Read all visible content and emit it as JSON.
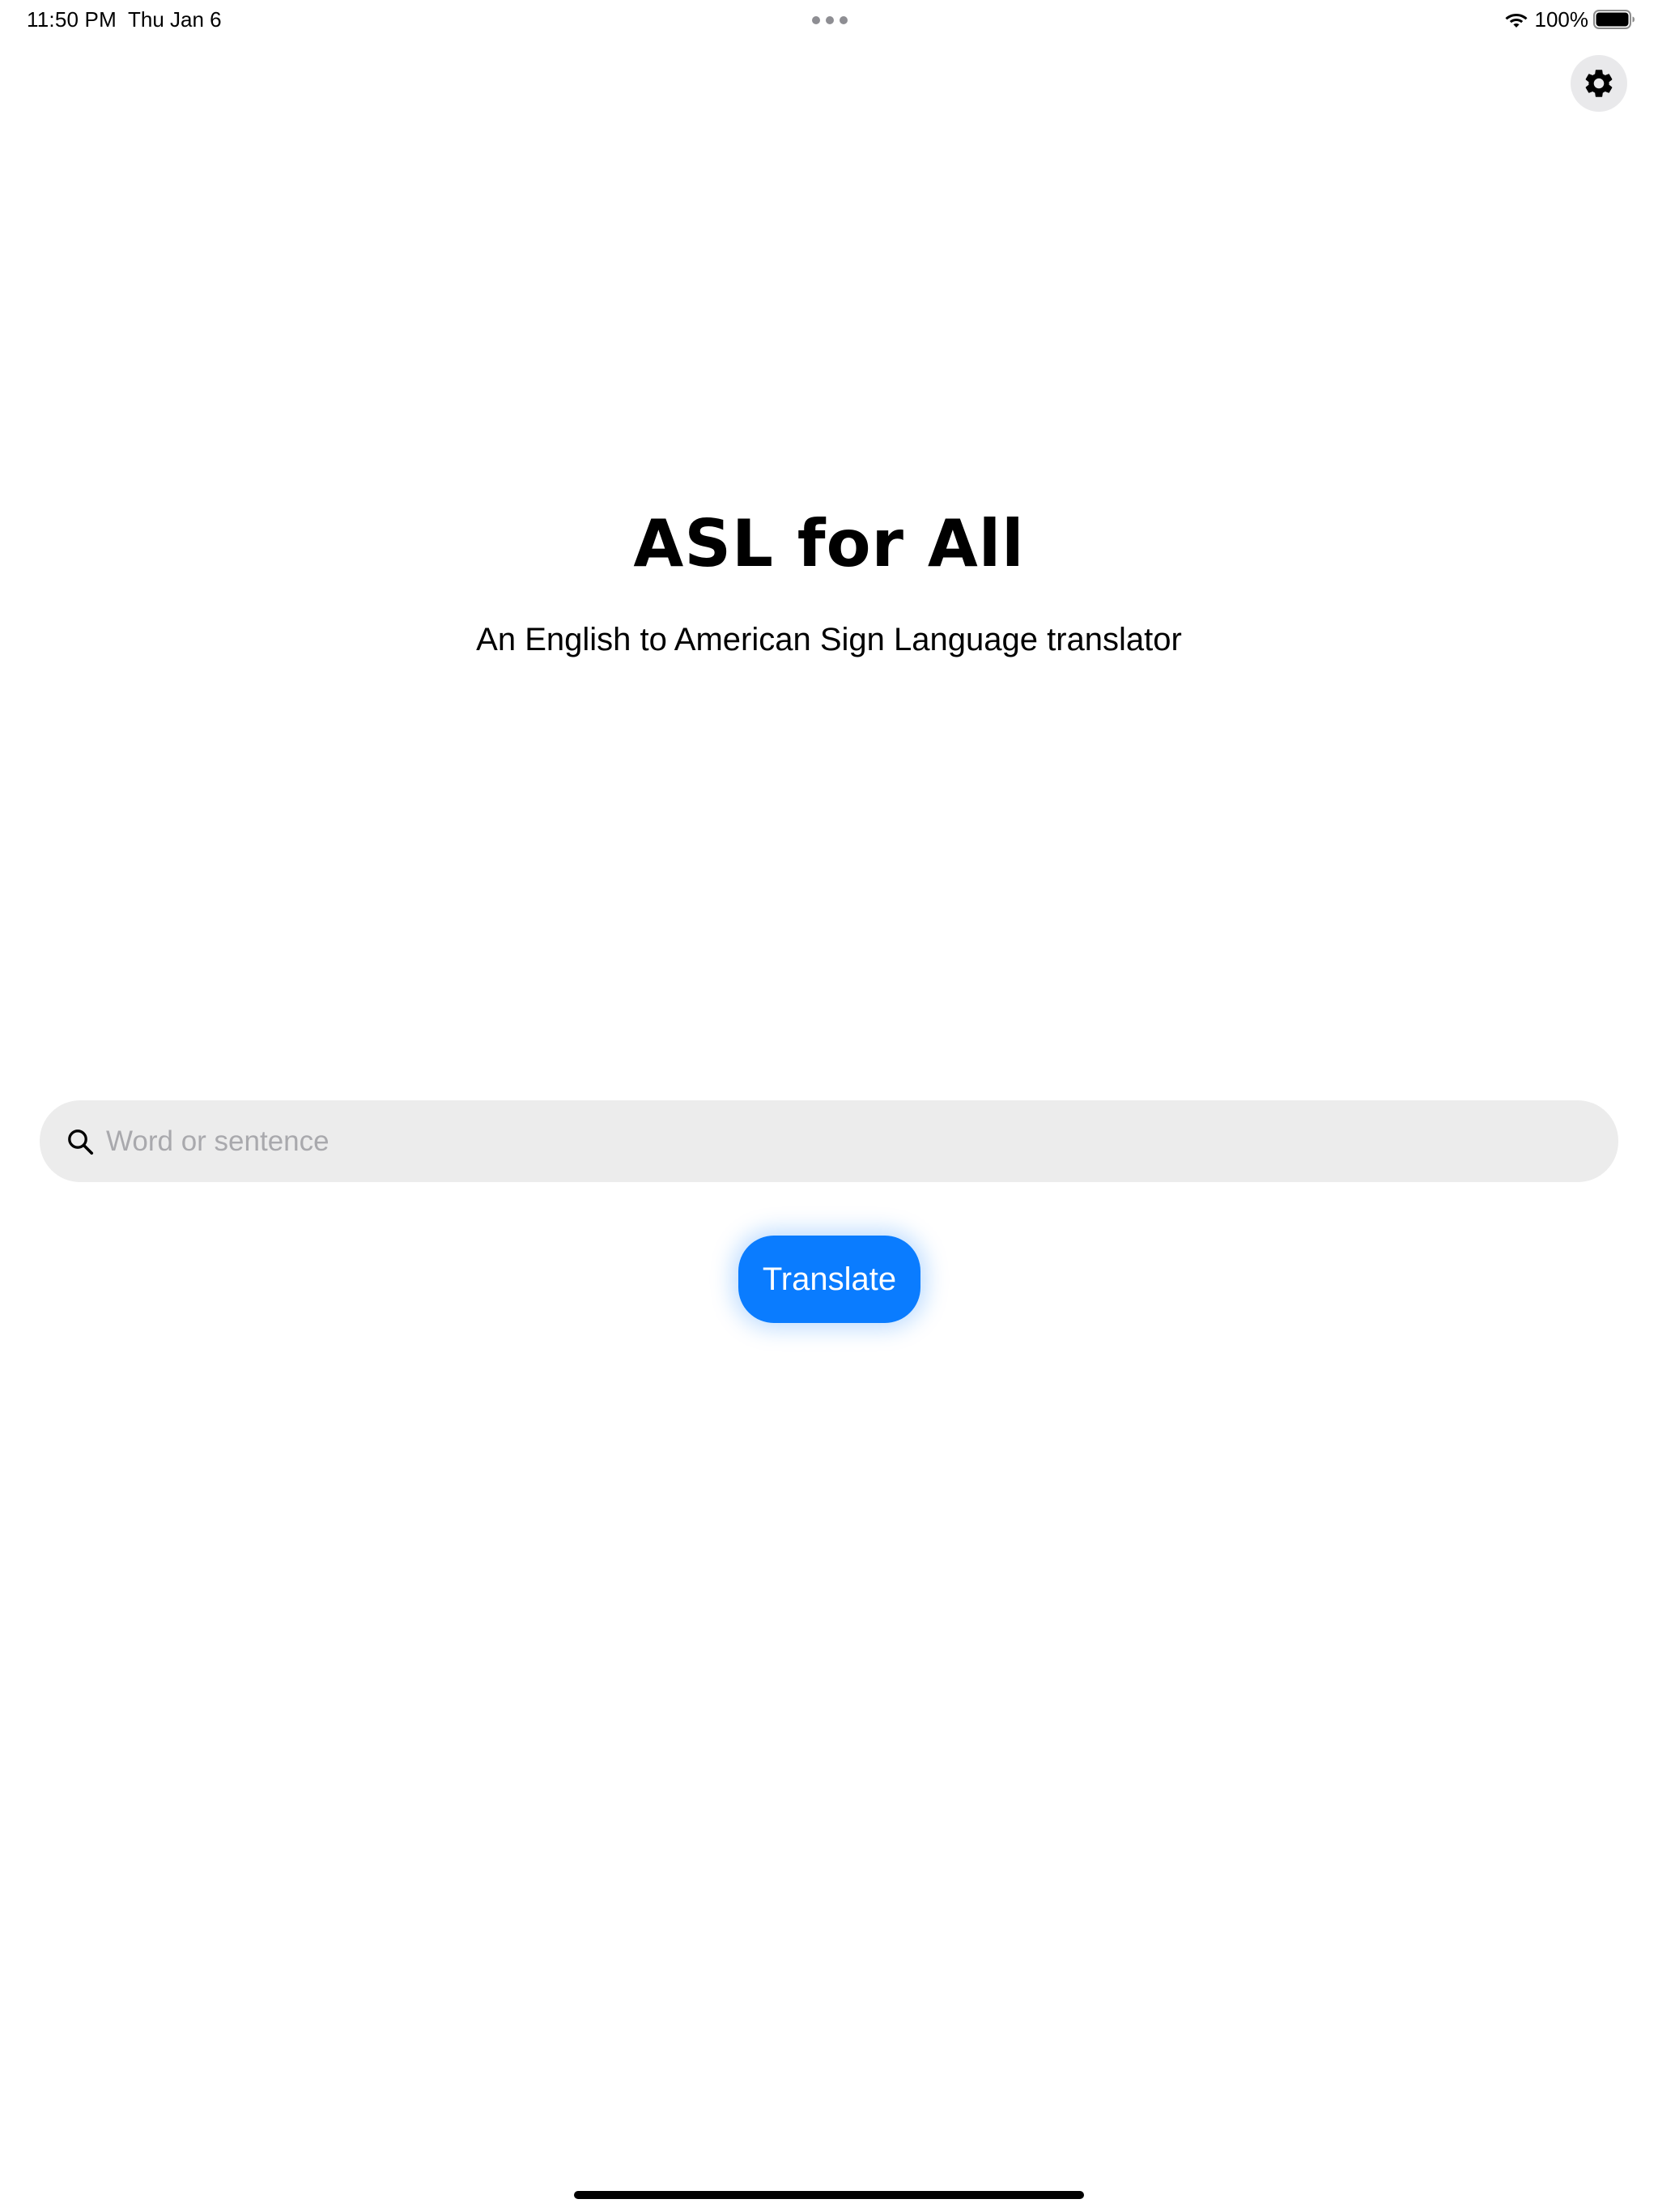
{
  "status_bar": {
    "time": "11:50 PM",
    "date": "Thu Jan 6",
    "battery_percent": "100%",
    "icons": [
      "wifi-icon",
      "battery-icon"
    ]
  },
  "header": {
    "settings_icon": "gear-icon"
  },
  "main": {
    "title": "ASL for All",
    "subtitle": "An English to American Sign Language translator"
  },
  "search": {
    "placeholder": "Word or sentence",
    "value": "",
    "icon": "search-icon"
  },
  "actions": {
    "translate_label": "Translate"
  },
  "colors": {
    "accent": "#0a7cff",
    "search_background": "#ececec",
    "settings_background": "#e9e9eb",
    "background": "#ffffff"
  }
}
